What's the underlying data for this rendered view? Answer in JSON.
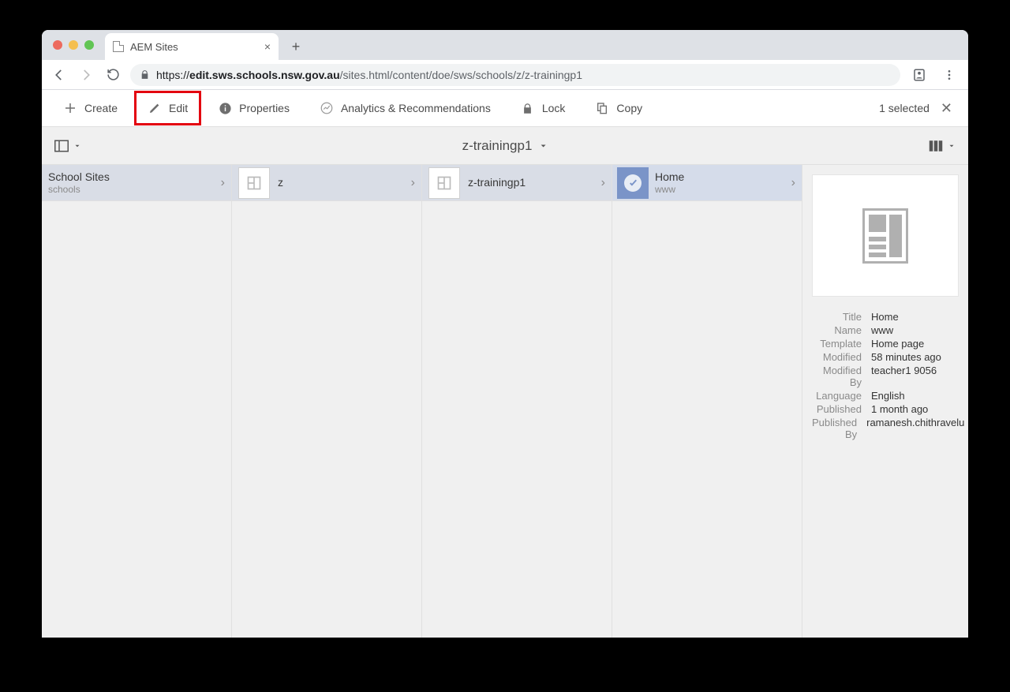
{
  "tab_title": "AEM Sites",
  "url_prefix": "https://",
  "url_bold": "edit.sws.schools.nsw.gov.au",
  "url_rest": "/sites.html/content/doe/sws/schools/z/z-trainingp1",
  "actions": {
    "create": "Create",
    "edit": "Edit",
    "properties": "Properties",
    "analytics": "Analytics & Recommendations",
    "lock": "Lock",
    "copy": "Copy",
    "selected": "1 selected"
  },
  "breadcrumb_title": "z-trainingp1",
  "columns": [
    {
      "title": "School Sites",
      "sub": "schools",
      "active": true,
      "twoline": true
    },
    {
      "title": "z",
      "sub": "",
      "active": true,
      "twoline": false
    },
    {
      "title": "z-trainingp1",
      "sub": "",
      "active": true,
      "twoline": false
    },
    {
      "title": "Home",
      "sub": "www",
      "active": true,
      "twoline": true,
      "selected": true
    }
  ],
  "detail": {
    "rows": [
      {
        "k": "Title",
        "v": "Home"
      },
      {
        "k": "Name",
        "v": "www"
      },
      {
        "k": "Template",
        "v": "Home page"
      },
      {
        "k": "Modified",
        "v": "58 minutes ago"
      },
      {
        "k": "Modified By",
        "v": "teacher1 9056"
      },
      {
        "k": "Language",
        "v": "English"
      },
      {
        "k": "Published",
        "v": "1 month ago"
      },
      {
        "k": "Published By",
        "v": "ramanesh.chithravelu"
      }
    ]
  }
}
